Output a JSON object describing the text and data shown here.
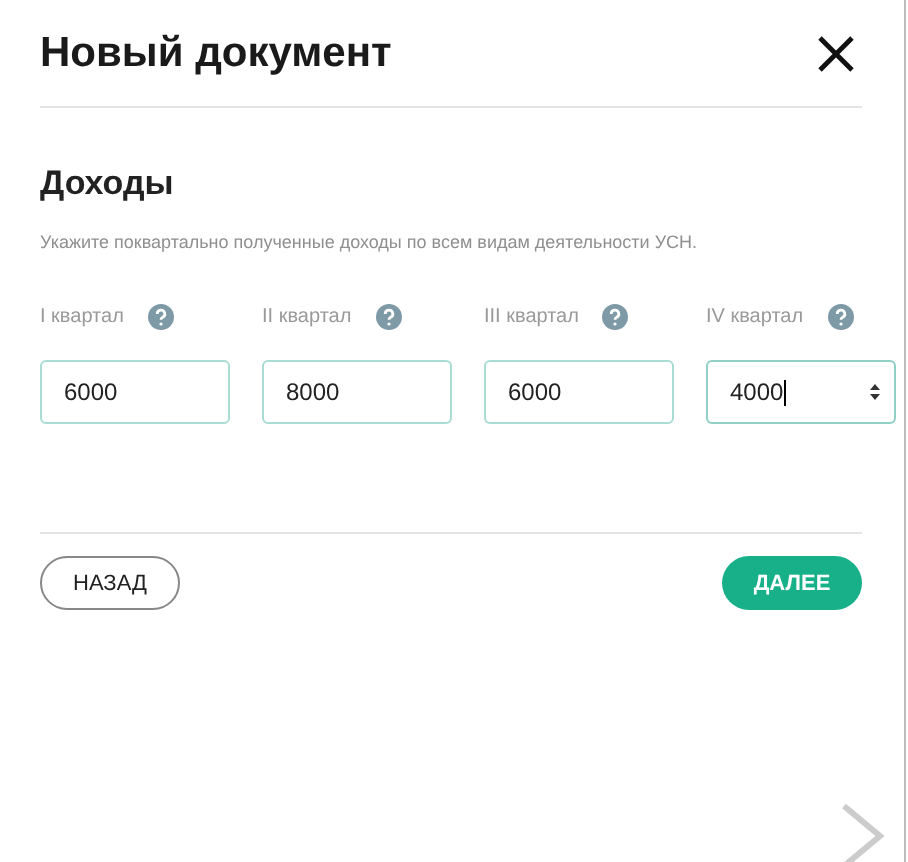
{
  "dialog": {
    "title": "Новый документ"
  },
  "section": {
    "heading": "Доходы",
    "hint": "Укажите поквартально полученные доходы по всем видам деятельности УСН."
  },
  "quarters": [
    {
      "label": "I квартал",
      "value": "6000",
      "focused": false
    },
    {
      "label": "II квартал",
      "value": "8000",
      "focused": false
    },
    {
      "label": "III квартал",
      "value": "6000",
      "focused": false
    },
    {
      "label": "IV квартал",
      "value": "4000",
      "focused": true
    }
  ],
  "buttons": {
    "back": "НАЗАД",
    "next": "ДАЛЕЕ"
  }
}
